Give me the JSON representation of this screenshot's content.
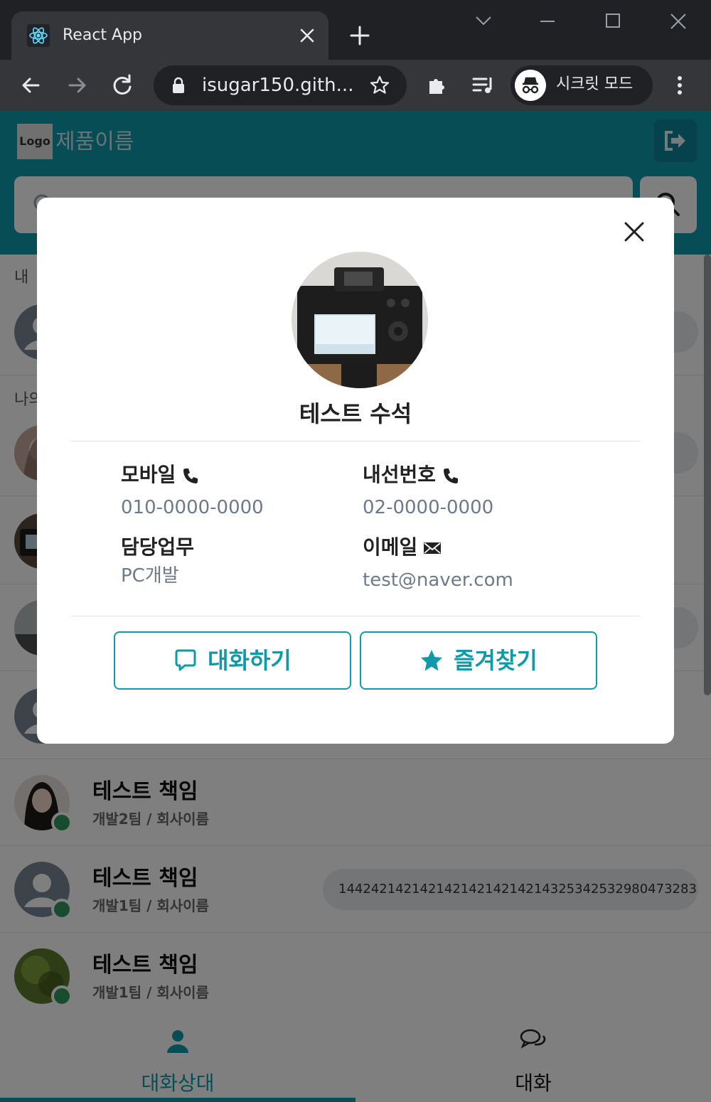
{
  "browser": {
    "tab_title": "React App",
    "url": "isugar150.gith...",
    "incognito_label": "시크릿 모드"
  },
  "app": {
    "logo_text": "Logo",
    "product_name": "제품이름",
    "sections": {
      "mine": "내",
      "others": "나의"
    },
    "contacts": [
      {
        "name": "테스트 책임",
        "dept": "개발2팀 / 회사이름",
        "message": ""
      },
      {
        "name": "테스트 책임",
        "dept": "개발1팀 / 회사이름",
        "message": "14424214214214214214214214325342532980473283..."
      },
      {
        "name": "테스트 책임",
        "dept": "개발1팀 / 회사이름",
        "message": ""
      }
    ],
    "bottom_nav": [
      {
        "label": "대화상대",
        "active": true
      },
      {
        "label": "대화",
        "active": false
      }
    ]
  },
  "modal": {
    "name": "테스트 수석",
    "mobile_label": "모바일",
    "mobile_value": "010-0000-0000",
    "extension_label": "내선번호",
    "extension_value": "02-0000-0000",
    "duty_label": "담당업무",
    "duty_value": "PC개발",
    "email_label": "이메일",
    "email_value": "test@naver.com",
    "chat_button": "대화하기",
    "favorite_button": "즐겨찾기"
  },
  "colors": {
    "accent": "#0f9aab",
    "online": "#2e9b5c",
    "browser_dark": "#202124",
    "browser_mid": "#35363a"
  }
}
